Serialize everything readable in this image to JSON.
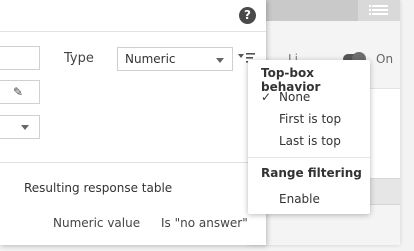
{
  "dialog": {
    "help_label": "?",
    "type_label": "Type",
    "type_value": "Numeric",
    "resulting_title": "Resulting response table",
    "columns": [
      "Numeric value",
      "Is \"no answer\""
    ]
  },
  "background": {
    "toggle_label": "Li...",
    "toggle_state": "On"
  },
  "menu": {
    "section_topbox": "Top-box behavior",
    "topbox_items": [
      {
        "label": "None",
        "checked": true
      },
      {
        "label": "First is top",
        "checked": false
      },
      {
        "label": "Last is top",
        "checked": false
      }
    ],
    "section_range": "Range filtering",
    "range_items": [
      {
        "label": "Enable"
      }
    ],
    "check_mark": "✓"
  }
}
